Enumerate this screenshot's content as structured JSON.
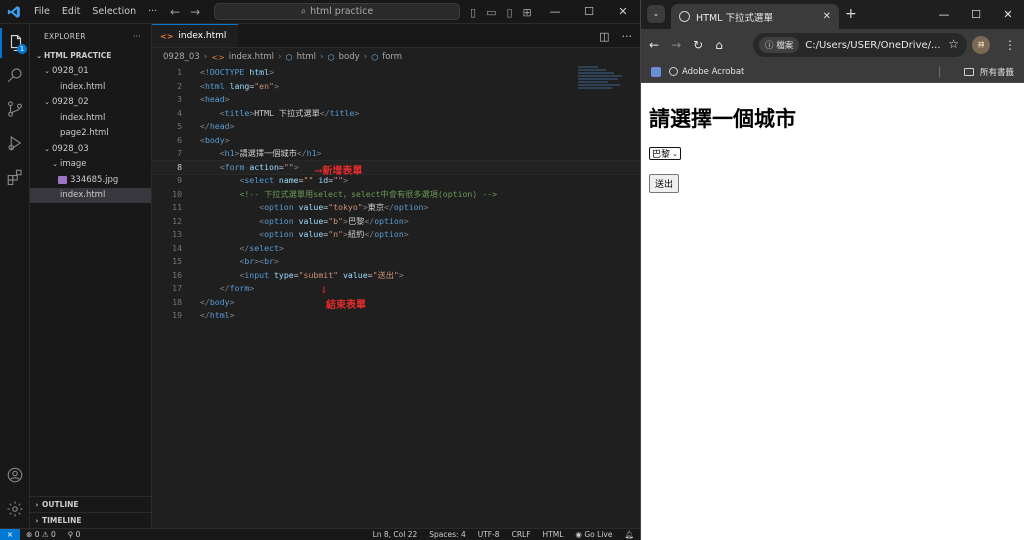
{
  "vscode": {
    "menu": [
      "File",
      "Edit",
      "Selection",
      "···"
    ],
    "command_center": "html practice",
    "explorer": {
      "title": "EXPLORER",
      "more": "···",
      "root": "HTML PRACTICE",
      "tree": [
        {
          "label": "0928_01",
          "type": "folder",
          "depth": 1
        },
        {
          "label": "index.html",
          "type": "file",
          "depth": 2
        },
        {
          "label": "0928_02",
          "type": "folder",
          "depth": 1
        },
        {
          "label": "index.html",
          "type": "file",
          "depth": 2
        },
        {
          "label": "page2.html",
          "type": "file",
          "depth": 2
        },
        {
          "label": "0928_03",
          "type": "folder",
          "depth": 1
        },
        {
          "label": "image",
          "type": "folder",
          "depth": 2
        },
        {
          "label": "334685.jpg",
          "type": "image",
          "depth": 3
        },
        {
          "label": "index.html",
          "type": "file",
          "depth": 2,
          "selected": true
        }
      ],
      "outline": "OUTLINE",
      "timeline": "TIMELINE"
    },
    "activity_badge": "1",
    "tab": {
      "label": "index.html"
    },
    "breadcrumbs": [
      "0928_03",
      "index.html",
      "html",
      "body",
      "form"
    ],
    "code_lines": [
      [
        [
          "t-br",
          "<!"
        ],
        [
          "t-tag",
          "DOCTYPE"
        ],
        [
          "t-txt",
          " "
        ],
        [
          "t-attr",
          "html"
        ],
        [
          "t-br",
          ">"
        ]
      ],
      [
        [
          "t-br",
          "<"
        ],
        [
          "t-tag",
          "html"
        ],
        [
          "t-txt",
          " "
        ],
        [
          "t-attr",
          "lang"
        ],
        [
          "t-txt",
          "="
        ],
        [
          "t-str",
          "\"en\""
        ],
        [
          "t-br",
          ">"
        ]
      ],
      [
        [
          "t-br",
          "<"
        ],
        [
          "t-tag",
          "head"
        ],
        [
          "t-br",
          ">"
        ]
      ],
      [
        [
          "t-txt",
          "    "
        ],
        [
          "t-br",
          "<"
        ],
        [
          "t-tag",
          "title"
        ],
        [
          "t-br",
          ">"
        ],
        [
          "t-txt",
          "HTML 下拉式選單"
        ],
        [
          "t-br",
          "</"
        ],
        [
          "t-tag",
          "title"
        ],
        [
          "t-br",
          ">"
        ]
      ],
      [
        [
          "t-br",
          "</"
        ],
        [
          "t-tag",
          "head"
        ],
        [
          "t-br",
          ">"
        ]
      ],
      [
        [
          "t-br",
          "<"
        ],
        [
          "t-tag",
          "body"
        ],
        [
          "t-br",
          ">"
        ]
      ],
      [
        [
          "t-txt",
          "    "
        ],
        [
          "t-br",
          "<"
        ],
        [
          "t-tag",
          "h1"
        ],
        [
          "t-br",
          ">"
        ],
        [
          "t-txt",
          "請選擇一個城市"
        ],
        [
          "t-br",
          "</"
        ],
        [
          "t-tag",
          "h1"
        ],
        [
          "t-br",
          ">"
        ]
      ],
      [
        [
          "t-txt",
          "    "
        ],
        [
          "t-br",
          "<"
        ],
        [
          "t-tag",
          "form"
        ],
        [
          "t-txt",
          " "
        ],
        [
          "t-attr",
          "action"
        ],
        [
          "t-txt",
          "="
        ],
        [
          "t-str",
          "\"\""
        ],
        [
          "t-br",
          ">"
        ]
      ],
      [
        [
          "t-txt",
          "        "
        ],
        [
          "t-br",
          "<"
        ],
        [
          "t-tag",
          "select"
        ],
        [
          "t-txt",
          " "
        ],
        [
          "t-attr",
          "name"
        ],
        [
          "t-txt",
          "="
        ],
        [
          "t-str",
          "\"\""
        ],
        [
          "t-txt",
          " "
        ],
        [
          "t-attr",
          "id"
        ],
        [
          "t-txt",
          "="
        ],
        [
          "t-str",
          "\"\""
        ],
        [
          "t-br",
          ">"
        ]
      ],
      [
        [
          "t-txt",
          "        "
        ],
        [
          "t-com",
          "<!-- 下拉式選單用select，select中會有很多選項(option) -->"
        ]
      ],
      [
        [
          "t-txt",
          "            "
        ],
        [
          "t-br",
          "<"
        ],
        [
          "t-tag",
          "option"
        ],
        [
          "t-txt",
          " "
        ],
        [
          "t-attr",
          "value"
        ],
        [
          "t-txt",
          "="
        ],
        [
          "t-str",
          "\"tokyo\""
        ],
        [
          "t-br",
          ">"
        ],
        [
          "t-txt",
          "東京"
        ],
        [
          "t-br",
          "</"
        ],
        [
          "t-tag",
          "option"
        ],
        [
          "t-br",
          ">"
        ]
      ],
      [
        [
          "t-txt",
          "            "
        ],
        [
          "t-br",
          "<"
        ],
        [
          "t-tag",
          "option"
        ],
        [
          "t-txt",
          " "
        ],
        [
          "t-attr",
          "value"
        ],
        [
          "t-txt",
          "="
        ],
        [
          "t-str",
          "\"b\""
        ],
        [
          "t-br",
          ">"
        ],
        [
          "t-txt",
          "巴黎"
        ],
        [
          "t-br",
          "</"
        ],
        [
          "t-tag",
          "option"
        ],
        [
          "t-br",
          ">"
        ]
      ],
      [
        [
          "t-txt",
          "            "
        ],
        [
          "t-br",
          "<"
        ],
        [
          "t-tag",
          "option"
        ],
        [
          "t-txt",
          " "
        ],
        [
          "t-attr",
          "value"
        ],
        [
          "t-txt",
          "="
        ],
        [
          "t-str",
          "\"n\""
        ],
        [
          "t-br",
          ">"
        ],
        [
          "t-txt",
          "紐約"
        ],
        [
          "t-br",
          "</"
        ],
        [
          "t-tag",
          "option"
        ],
        [
          "t-br",
          ">"
        ]
      ],
      [
        [
          "t-txt",
          "        "
        ],
        [
          "t-br",
          "</"
        ],
        [
          "t-tag",
          "select"
        ],
        [
          "t-br",
          ">"
        ]
      ],
      [
        [
          "t-txt",
          "        "
        ],
        [
          "t-br",
          "<"
        ],
        [
          "t-tag",
          "br"
        ],
        [
          "t-br",
          "><"
        ],
        [
          "t-tag",
          "br"
        ],
        [
          "t-br",
          ">"
        ]
      ],
      [
        [
          "t-txt",
          "        "
        ],
        [
          "t-br",
          "<"
        ],
        [
          "t-tag",
          "input"
        ],
        [
          "t-txt",
          " "
        ],
        [
          "t-attr",
          "type"
        ],
        [
          "t-txt",
          "="
        ],
        [
          "t-str",
          "\"submit\""
        ],
        [
          "t-txt",
          " "
        ],
        [
          "t-attr",
          "value"
        ],
        [
          "t-txt",
          "="
        ],
        [
          "t-str",
          "\"送出\""
        ],
        [
          "t-br",
          ">"
        ]
      ],
      [
        [
          "t-txt",
          "    "
        ],
        [
          "t-br",
          "</"
        ],
        [
          "t-tag",
          "form"
        ],
        [
          "t-br",
          ">"
        ]
      ],
      [
        [
          "t-br",
          "</"
        ],
        [
          "t-tag",
          "body"
        ],
        [
          "t-br",
          ">"
        ]
      ],
      [
        [
          "t-br",
          "</"
        ],
        [
          "t-tag",
          "html"
        ],
        [
          "t-br",
          ">"
        ]
      ]
    ],
    "current_line": 8,
    "annotations": {
      "start_tag": "新增表單",
      "end_tag": "結束表單"
    },
    "status": {
      "errors": "0",
      "warnings": "0",
      "ports": "0",
      "position": "Ln 8, Col 22",
      "spaces": "Spaces: 4",
      "encoding": "UTF-8",
      "eol": "CRLF",
      "language": "HTML",
      "golive": "Go Live"
    }
  },
  "chrome": {
    "tab_title": "HTML 下拉式選單",
    "omnibox_chip": "檔案",
    "url": "C:/Users/USER/OneDrive/...",
    "profile_text": "神",
    "bookmarks": {
      "item": "Adobe Acrobat",
      "all": "所有書籤"
    },
    "page": {
      "heading": "請選擇一個城市",
      "select_value": "巴黎",
      "submit_label": "送出"
    }
  },
  "colors": {
    "accent": "#0078d4",
    "annotation": "#e52b2b"
  }
}
